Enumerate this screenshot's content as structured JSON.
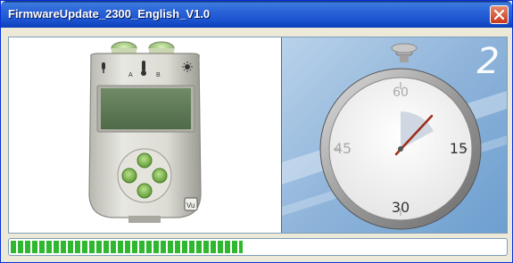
{
  "window": {
    "title": "FirmwareUpdate_2300_English_V1.0"
  },
  "device": {
    "logo_text": "Vu",
    "port_labels": [
      "A",
      "B"
    ]
  },
  "stopwatch": {
    "dial_numbers": {
      "top": "60",
      "right": "15",
      "bottom": "30",
      "left": "45"
    },
    "counter": "2"
  },
  "progress": {
    "value": 0.47
  },
  "icons": {
    "close": "close-icon",
    "microphone": "microphone-icon",
    "thermometer": "thermometer-icon",
    "light": "light-icon"
  }
}
